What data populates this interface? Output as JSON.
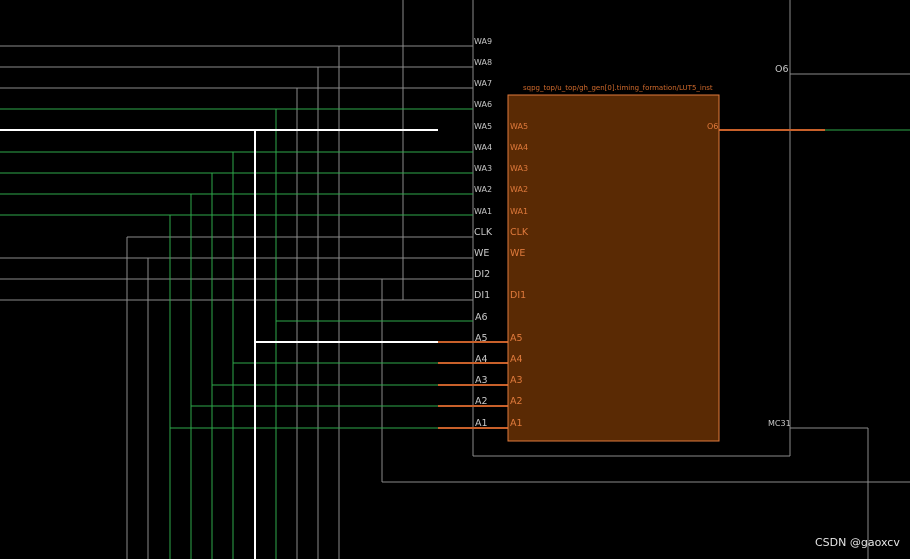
{
  "schematic": {
    "cell_name": "sqpg_top/u_top/gh_gen[0].timing_formation/LUT5_inst",
    "outer_pins": {
      "wa9": "WA9",
      "wa8": "WA8",
      "wa7": "WA7",
      "wa6": "WA6",
      "wa5": "WA5",
      "wa4": "WA4",
      "wa3": "WA3",
      "wa2": "WA2",
      "wa1": "WA1",
      "clk": "CLK",
      "we": "WE",
      "di2": "DI2",
      "di1": "DI1",
      "a6": "A6",
      "a5": "A5",
      "a4": "A4",
      "a3": "A3",
      "a2": "A2",
      "a1": "A1",
      "o6": "O6",
      "mc31": "MC31"
    },
    "inner_pins": {
      "wa5": "WA5",
      "wa4": "WA4",
      "wa3": "WA3",
      "wa2": "WA2",
      "wa1": "WA1",
      "clk": "CLK",
      "we": "WE",
      "di1": "DI1",
      "a5": "A5",
      "a4": "A4",
      "a3": "A3",
      "a2": "A2",
      "a1": "A1",
      "o6": "O6"
    },
    "colors": {
      "background": "#000000",
      "cell_fill": "#5a2a04",
      "cell_border": "#e07a3c",
      "wire_gray": "#8a8a8a",
      "wire_green": "#2ea84a",
      "wire_selected": "#ffffff",
      "wire_highlight": "#c8602a"
    }
  },
  "watermark": "CSDN @gaoxcv"
}
